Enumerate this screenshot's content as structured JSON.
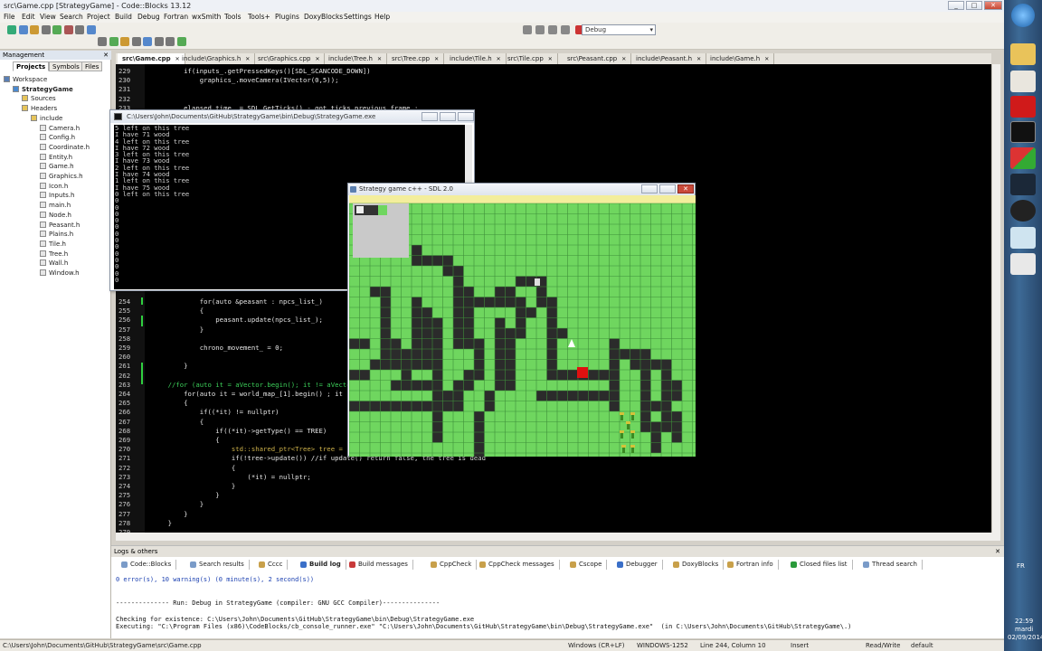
{
  "window": {
    "title": "src\\Game.cpp [StrategyGame] - Code::Blocks 13.12",
    "min": "_",
    "max": "□",
    "close": "✕"
  },
  "menu": [
    "File",
    "Edit",
    "View",
    "Search",
    "Project",
    "Build",
    "Debug",
    "Fortran",
    "wxSmith",
    "Tools",
    "Tools+",
    "Plugins",
    "DoxyBlocks",
    "Settings",
    "Help"
  ],
  "toolbar": {
    "build_target": "Debug"
  },
  "management": {
    "title": "Management",
    "close": "✕",
    "tabs": [
      "Projects",
      "Symbols",
      "Files"
    ],
    "tree": [
      {
        "label": "Workspace",
        "depth": 0,
        "icon": "workspace-icon"
      },
      {
        "label": "StrategyGame",
        "depth": 1,
        "icon": "project-icon",
        "bold": true
      },
      {
        "label": "Sources",
        "depth": 2,
        "icon": "folder-icon"
      },
      {
        "label": "Headers",
        "depth": 2,
        "icon": "folder-icon"
      },
      {
        "label": "include",
        "depth": 3,
        "icon": "folder-icon"
      },
      {
        "label": "Camera.h",
        "depth": 4,
        "icon": "file-icon"
      },
      {
        "label": "Config.h",
        "depth": 4,
        "icon": "file-icon"
      },
      {
        "label": "Coordinate.h",
        "depth": 4,
        "icon": "file-icon"
      },
      {
        "label": "Entity.h",
        "depth": 4,
        "icon": "file-icon"
      },
      {
        "label": "Game.h",
        "depth": 4,
        "icon": "file-icon"
      },
      {
        "label": "Graphics.h",
        "depth": 4,
        "icon": "file-icon"
      },
      {
        "label": "Icon.h",
        "depth": 4,
        "icon": "file-icon"
      },
      {
        "label": "Inputs.h",
        "depth": 4,
        "icon": "file-icon"
      },
      {
        "label": "main.h",
        "depth": 4,
        "icon": "file-icon"
      },
      {
        "label": "Node.h",
        "depth": 4,
        "icon": "file-icon"
      },
      {
        "label": "Peasant.h",
        "depth": 4,
        "icon": "file-icon"
      },
      {
        "label": "Plains.h",
        "depth": 4,
        "icon": "file-icon"
      },
      {
        "label": "Tile.h",
        "depth": 4,
        "icon": "file-icon"
      },
      {
        "label": "Tree.h",
        "depth": 4,
        "icon": "file-icon"
      },
      {
        "label": "Wall.h",
        "depth": 4,
        "icon": "file-icon"
      },
      {
        "label": "Window.h",
        "depth": 4,
        "icon": "file-icon"
      }
    ]
  },
  "editor_tabs": [
    "src\\Game.cpp",
    "include\\Graphics.h",
    "src\\Graphics.cpp",
    "include\\Tree.h",
    "src\\Tree.cpp",
    "include\\Tile.h",
    "src\\Tile.cpp",
    "src\\Peasant.cpp",
    "include\\Peasant.h",
    "include\\Game.h"
  ],
  "editor_tabs_close": "✕",
  "code_top": [
    {
      "n": "229",
      "t": "        if(inputs_.getPressedKeys()[SDL_SCANCODE_DOWN])"
    },
    {
      "n": "230",
      "t": "            graphics_.moveCamera(IVector(0,5));"
    },
    {
      "n": "231",
      "t": ""
    },
    {
      "n": "232",
      "t": ""
    },
    {
      "n": "233",
      "t": "        elapsed_time_ = SDL_GetTicks() - got_ticks_previous_frame_;"
    }
  ],
  "code_bottom": [
    {
      "n": "254",
      "t": "            for(auto &peasant : npcs_list_)"
    },
    {
      "n": "255",
      "t": "            {"
    },
    {
      "n": "256",
      "t": "                peasant.update(npcs_list_);"
    },
    {
      "n": "257",
      "t": "            }"
    },
    {
      "n": "258",
      "t": ""
    },
    {
      "n": "259",
      "t": "            chrono_movement_ = 0;"
    },
    {
      "n": "260",
      "t": ""
    },
    {
      "n": "261",
      "t": "        }"
    },
    {
      "n": "262",
      "t": ""
    },
    {
      "n": "263",
      "t": "    //for (auto it = aVector.begin(); it != aVector.end(); ++it)"
    },
    {
      "n": "264",
      "t": "        for(auto it = world_map_[1].begin() ; it != world_map_[1].end(); it++)"
    },
    {
      "n": "265",
      "t": "        {"
    },
    {
      "n": "266",
      "t": "            if((*it) != nullptr)"
    },
    {
      "n": "267",
      "t": "            {"
    },
    {
      "n": "268",
      "t": "                if((*it)->getType() == TREE)"
    },
    {
      "n": "269",
      "t": "                {"
    },
    {
      "n": "270",
      "t": "                    std::shared_ptr<Tree> tree = std::static_pointer_cast<Tree>(*it);"
    },
    {
      "n": "271",
      "t": "                    if(!tree->update()) //if update() return false, the tree is dead"
    },
    {
      "n": "272",
      "t": "                    {"
    },
    {
      "n": "273",
      "t": "                        (*it) = nullptr;"
    },
    {
      "n": "274",
      "t": "                    }"
    },
    {
      "n": "275",
      "t": "                }"
    },
    {
      "n": "276",
      "t": "            }"
    },
    {
      "n": "277",
      "t": "        }"
    },
    {
      "n": "278",
      "t": "    }"
    },
    {
      "n": "279",
      "t": ""
    }
  ],
  "console": {
    "title": "C:\\Users\\John\\Documents\\GitHub\\StrategyGame\\bin\\Debug\\StrategyGame.exe",
    "lines": [
      "5 left on this tree",
      "I have 71 wood",
      "4 left on this tree",
      "I have 72 wood",
      "3 left on this tree",
      "I have 73 wood",
      "2 left on this tree",
      "I have 74 wood",
      "1 left on this tree",
      "I have 75 wood",
      "0 left on this tree",
      "0",
      "0",
      "0",
      "0",
      "0",
      "0",
      "0",
      "0",
      "0",
      "0",
      "0",
      "0",
      "0"
    ]
  },
  "sdl": {
    "title": "Strategy game c++ - SDL 2.0",
    "close": "✕"
  },
  "logs": {
    "title": "Logs & others",
    "close": "✕",
    "tabs": [
      {
        "label": "Code::Blocks",
        "color": "#7a9bc8"
      },
      {
        "label": "Search results",
        "color": "#7a9bc8"
      },
      {
        "label": "Cccc",
        "color": "#c8a04a"
      },
      {
        "label": "Build log",
        "color": "#3a6fc8",
        "active": true
      },
      {
        "label": "Build messages",
        "color": "#c83a3a"
      },
      {
        "label": "CppCheck",
        "color": "#c8a04a"
      },
      {
        "label": "CppCheck messages",
        "color": "#c8a04a"
      },
      {
        "label": "Cscope",
        "color": "#c8a04a"
      },
      {
        "label": "Debugger",
        "color": "#3a6fc8"
      },
      {
        "label": "DoxyBlocks",
        "color": "#c8a04a"
      },
      {
        "label": "Fortran info",
        "color": "#c8a04a"
      },
      {
        "label": "Closed files list",
        "color": "#2a9a3a"
      },
      {
        "label": "Thread search",
        "color": "#7a9bc8"
      }
    ],
    "lines": [
      {
        "t": "0 error(s), 10 warning(s) (0 minute(s), 2 second(s))",
        "c": "#1a3fb0"
      },
      {
        "t": "",
        "c": "#111"
      },
      {
        "t": "",
        "c": "#111"
      },
      {
        "t": "-------------- Run: Debug in StrategyGame (compiler: GNU GCC Compiler)---------------",
        "c": "#111"
      },
      {
        "t": "",
        "c": "#111"
      },
      {
        "t": "Checking for existence: C:\\Users\\John\\Documents\\GitHub\\StrategyGame\\bin\\Debug\\StrategyGame.exe",
        "c": "#111"
      },
      {
        "t": "Executing: \"C:\\Program Files (x86)\\CodeBlocks/cb_console_runner.exe\" \"C:\\Users\\John\\Documents\\GitHub\\StrategyGame\\bin\\Debug\\StrategyGame.exe\"  (in C:\\Users\\John\\Documents\\GitHub\\StrategyGame\\.)",
        "c": "#111"
      }
    ]
  },
  "status": {
    "path": "C:\\Users\\John\\Documents\\GitHub\\StrategyGame\\src\\Game.cpp",
    "eol": "Windows (CR+LF)",
    "encoding": "WINDOWS-1252",
    "position": "Line 244, Column 10",
    "mode": "Insert",
    "access": "Read/Write",
    "lang": "default"
  },
  "tray": {
    "lang": "FR",
    "time": "22:59",
    "day": "mardi",
    "date": "02/09/2014"
  },
  "colors": {
    "grass": "#6fd65f",
    "road": "#2b2b2b",
    "grid": "#3f8f3a",
    "sand": "#f3ee9c",
    "minimap": "#c9c9c9",
    "player": "#e01010"
  }
}
